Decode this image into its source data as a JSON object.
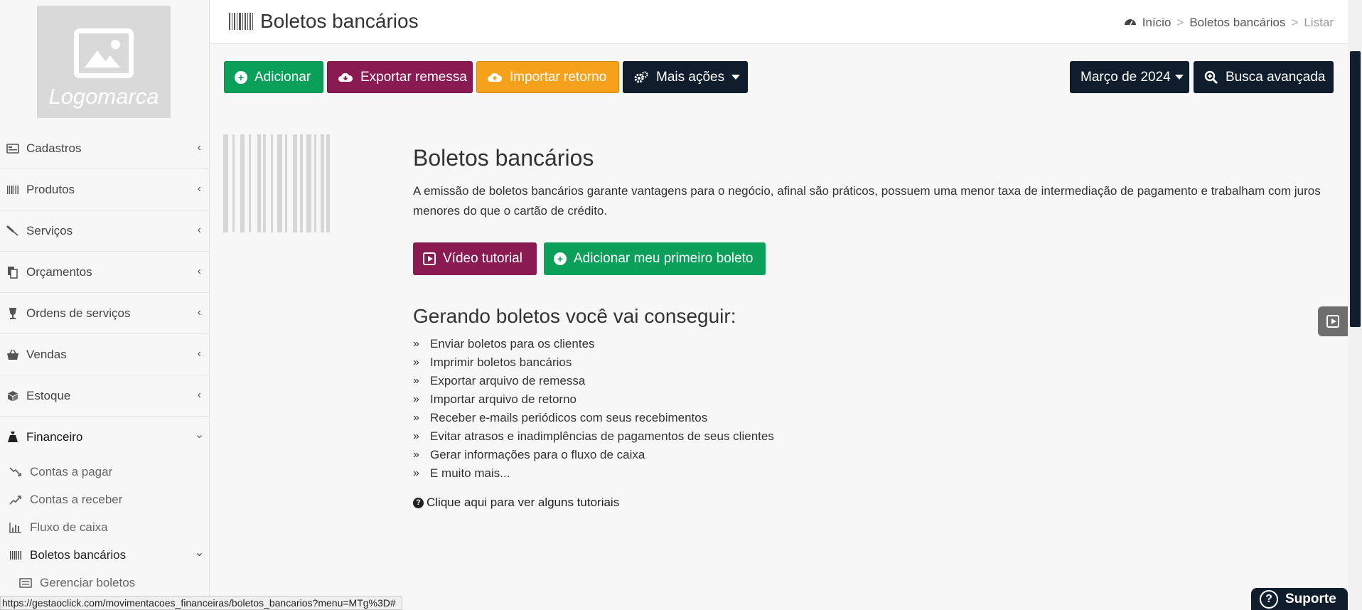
{
  "logo": {
    "text": "Logomarca"
  },
  "sidebar": {
    "items": [
      {
        "label": "Cadastros",
        "icon": "id-card-icon"
      },
      {
        "label": "Produtos",
        "icon": "barcode-icon"
      },
      {
        "label": "Serviços",
        "icon": "screwdriver-icon"
      },
      {
        "label": "Orçamentos",
        "icon": "copy-icon"
      },
      {
        "label": "Ordens de serviços",
        "icon": "wine-glass-icon"
      },
      {
        "label": "Vendas",
        "icon": "basket-icon"
      },
      {
        "label": "Estoque",
        "icon": "cube-icon"
      },
      {
        "label": "Financeiro",
        "icon": "money-bag-icon"
      }
    ],
    "financeiro_sub": [
      {
        "label": "Contas a pagar",
        "icon": "trend-down-icon"
      },
      {
        "label": "Contas a receber",
        "icon": "trend-up-icon"
      },
      {
        "label": "Fluxo de caixa",
        "icon": "bar-chart-icon"
      },
      {
        "label": "Boletos bancários",
        "icon": "barcode-icon"
      }
    ],
    "boletos_sub": [
      {
        "label": "Gerenciar boletos",
        "icon": "list-icon"
      }
    ]
  },
  "header": {
    "title": "Boletos bancários",
    "breadcrumbs": [
      "Início",
      "Boletos bancários",
      "Listar"
    ],
    "breadcrumb_sep": ">"
  },
  "toolbar": {
    "add": "Adicionar",
    "export": "Exportar remessa",
    "import": "Importar retorno",
    "more": "Mais ações",
    "month": "Março de 2024",
    "search": "Busca avançada"
  },
  "content": {
    "title": "Boletos bancários",
    "description": "A emissão de boletos bancários garante vantagens para o negócio, afinal são práticos, possuem uma menor taxa de intermediação de pagamento e trabalham com juros menores do que o cartão de crédito.",
    "video_button": "Vídeo tutorial",
    "first_button": "Adicionar meu primeiro boleto",
    "subtitle": "Gerando boletos você vai conseguir:",
    "benefits": [
      "Enviar boletos para os clientes",
      "Imprimir boletos bancários",
      "Exportar arquivo de remessa",
      "Importar arquivo de retorno",
      "Receber e-mails periódicos com seus recebimentos",
      "Evitar atrasos e inadimplências de pagamentos de seus clientes",
      "Gerar informações para o fluxo de caixa",
      "E muito mais..."
    ],
    "tutorial_link": "Clique aqui para ver alguns tutoriais"
  },
  "support": {
    "label": "Suporte"
  },
  "statusbar": {
    "url": "https://gestaoclick.com/movimentacoes_financeiras/boletos_bancarios?menu=MTg%3D#"
  },
  "colors": {
    "green": "#0aa05a",
    "purple": "#8a1a52",
    "orange": "#f5a11b",
    "dark": "#0f1d2c"
  }
}
